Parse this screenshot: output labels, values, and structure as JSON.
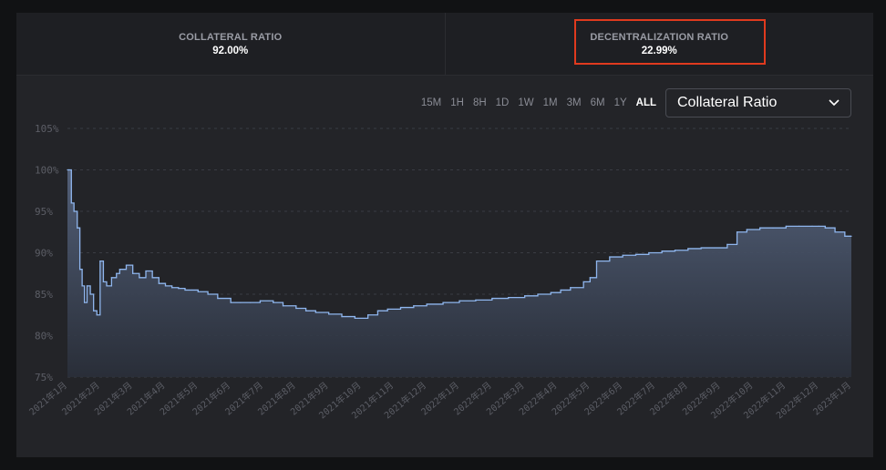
{
  "stats": {
    "collateral": {
      "label": "COLLATERAL RATIO",
      "value": "92.00%"
    },
    "decentralization": {
      "label": "DECENTRALIZATION RATIO",
      "value": "22.99%"
    }
  },
  "highlight_color": "#e03a1e",
  "toolbar": {
    "ranges": [
      "15M",
      "1H",
      "8H",
      "1D",
      "1W",
      "1M",
      "3M",
      "6M",
      "1Y",
      "ALL"
    ],
    "active_range": "ALL",
    "select_value": "Collateral Ratio",
    "select_icon": "chevron-down-icon"
  },
  "chart_data": {
    "type": "area",
    "title": "",
    "xlabel": "",
    "ylabel": "",
    "ylim": [
      75,
      105
    ],
    "y_ticks": [
      75,
      80,
      85,
      90,
      95,
      100,
      105
    ],
    "y_tick_labels": [
      "75%",
      "80%",
      "85%",
      "90%",
      "95%",
      "100%",
      "105%"
    ],
    "x_tick_labels": [
      "2021年1月",
      "2021年2月",
      "2021年3月",
      "2021年4月",
      "2021年5月",
      "2021年6月",
      "2021年7月",
      "2021年8月",
      "2021年9月",
      "2021年10月",
      "2021年11月",
      "2021年12月",
      "2022年1月",
      "2022年2月",
      "2022年3月",
      "2022年4月",
      "2022年5月",
      "2022年6月",
      "2022年7月",
      "2022年8月",
      "2022年9月",
      "2022年10月",
      "2022年11月",
      "2022年12月",
      "2023年1月"
    ],
    "grid": true,
    "line_color": "#8fb6ee",
    "series": [
      {
        "x": [
          0,
          0.05,
          0.12,
          0.2,
          0.3,
          0.38,
          0.45,
          0.52,
          0.6,
          0.7,
          0.8,
          0.9,
          1.0,
          1.1,
          1.2,
          1.35,
          1.5,
          1.6,
          1.8,
          2.0,
          2.2,
          2.4,
          2.6,
          2.8,
          3.0,
          3.2,
          3.4,
          3.6,
          3.8,
          4.0,
          4.3,
          4.6,
          5.0,
          5.3,
          5.6,
          5.9,
          6.3,
          6.6,
          7.0,
          7.3,
          7.6,
          8.0,
          8.4,
          8.8,
          9.2,
          9.5,
          9.8,
          10.2,
          10.6,
          11.0,
          11.5,
          12.0,
          12.5,
          13.0,
          13.5,
          14.0,
          14.4,
          14.8,
          15.1,
          15.4,
          15.8,
          16.0,
          16.2,
          16.6,
          17.0,
          17.4,
          17.8,
          18.2,
          18.6,
          19.0,
          19.4,
          19.8,
          20.2,
          20.5,
          20.8,
          21.2,
          21.6,
          22.0,
          22.4,
          22.8,
          23.0,
          23.2,
          23.5,
          23.8,
          24.0
        ],
        "y": [
          100,
          100,
          96,
          95,
          93,
          88,
          86,
          84,
          86,
          85,
          83,
          82.5,
          89,
          86.5,
          86,
          87,
          87.5,
          88,
          88.5,
          87.5,
          87,
          87.8,
          87,
          86.3,
          86,
          85.8,
          85.7,
          85.5,
          85.5,
          85.3,
          85,
          84.5,
          84,
          84,
          84,
          84.2,
          84,
          83.6,
          83.3,
          83,
          82.8,
          82.6,
          82.3,
          82.1,
          82.5,
          83,
          83.2,
          83.4,
          83.6,
          83.8,
          84,
          84.2,
          84.3,
          84.5,
          84.6,
          84.8,
          85,
          85.2,
          85.5,
          85.8,
          86.5,
          87,
          89,
          89.5,
          89.7,
          89.8,
          90,
          90.2,
          90.3,
          90.5,
          90.6,
          90.6,
          91,
          92.5,
          92.8,
          93,
          93,
          93.2,
          93.2,
          93.2,
          93.2,
          93,
          92.5,
          92,
          92
        ]
      }
    ]
  }
}
